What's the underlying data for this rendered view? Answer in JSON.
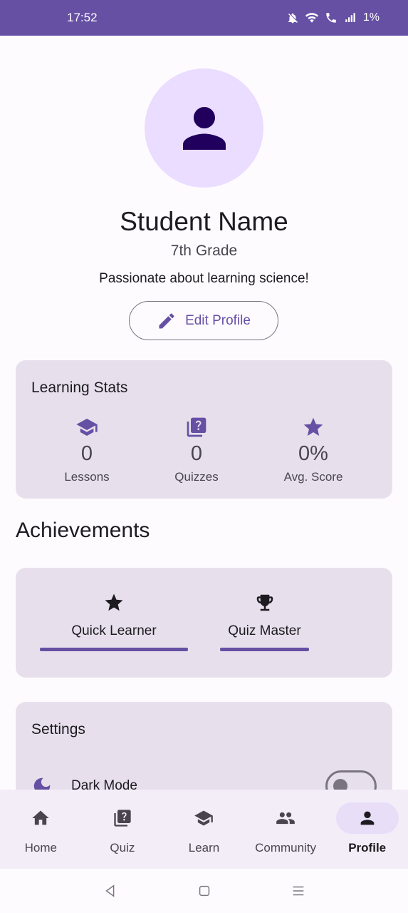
{
  "status": {
    "time": "17:52",
    "battery": "1%"
  },
  "profile": {
    "name": "Student Name",
    "grade": "7th Grade",
    "bio": "Passionate about learning science!",
    "edit_label": "Edit Profile"
  },
  "stats": {
    "title": "Learning Stats",
    "items": [
      {
        "icon": "school-icon",
        "value": "0",
        "label": "Lessons"
      },
      {
        "icon": "quiz-icon",
        "value": "0",
        "label": "Quizzes"
      },
      {
        "icon": "star-icon",
        "value": "0%",
        "label": "Avg. Score"
      }
    ]
  },
  "achievements": {
    "title": "Achievements",
    "items": [
      {
        "icon": "star-icon",
        "label": "Quick Learner"
      },
      {
        "icon": "trophy-icon",
        "label": "Quiz Master"
      }
    ]
  },
  "settings": {
    "title": "Settings",
    "items": [
      {
        "icon": "moon-icon",
        "label": "Dark Mode",
        "enabled": false
      }
    ]
  },
  "nav": {
    "items": [
      {
        "icon": "home-icon",
        "label": "Home",
        "active": false
      },
      {
        "icon": "quiz-icon",
        "label": "Quiz",
        "active": false
      },
      {
        "icon": "school-icon",
        "label": "Learn",
        "active": false
      },
      {
        "icon": "people-icon",
        "label": "Community",
        "active": false
      },
      {
        "icon": "person-icon",
        "label": "Profile",
        "active": true
      }
    ]
  },
  "colors": {
    "primary": "#6650a4",
    "primary_container": "#eaddff",
    "surface_variant": "#e7e0ec",
    "nav_background": "#f3edf7"
  }
}
